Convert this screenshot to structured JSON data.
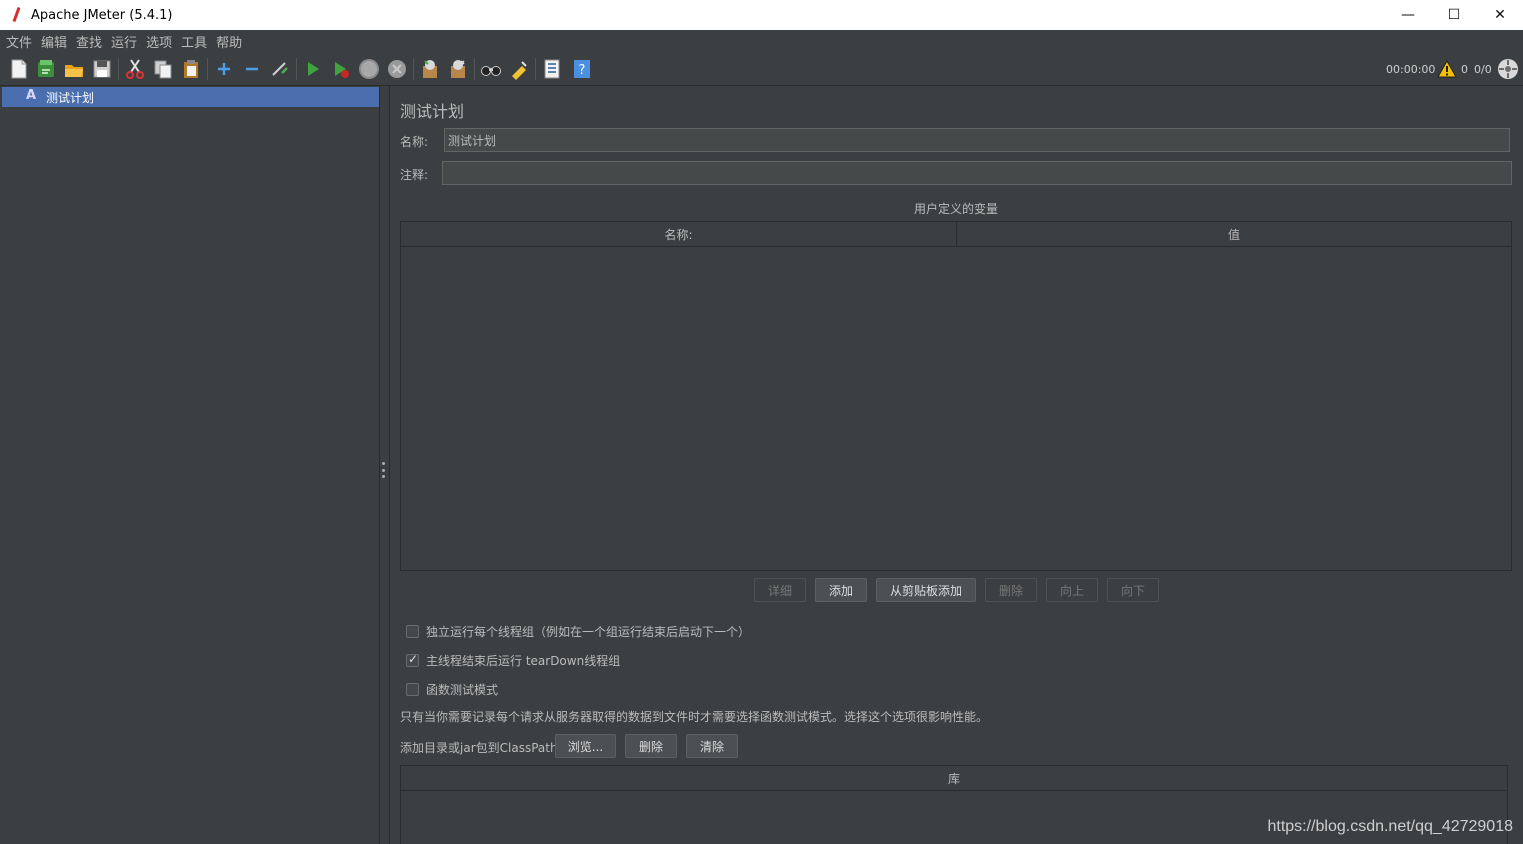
{
  "window": {
    "title": "Apache JMeter (5.4.1)",
    "minimize": "—",
    "maximize": "☐",
    "close": "✕"
  },
  "menu": [
    "文件",
    "编辑",
    "查找",
    "运行",
    "选项",
    "工具",
    "帮助"
  ],
  "toolbar": {
    "icons": [
      "new-icon",
      "templates-icon",
      "open-icon",
      "save-icon",
      "cut-icon",
      "copy-icon",
      "paste-icon",
      "expand-icon",
      "collapse-icon",
      "toggle-icon",
      "start-icon",
      "start-no-pause-icon",
      "stop-icon",
      "shutdown-icon",
      "clear-icon",
      "clear-all-icon",
      "search-icon",
      "reset-search-icon",
      "function-helper-icon",
      "help-icon"
    ],
    "colors": {
      "start": "#3fa33f",
      "accent": "#4b6eaf"
    },
    "timer": "00:00:00",
    "warning_count": "0",
    "threads": "0/0"
  },
  "tree": {
    "selected_item": "测试计划"
  },
  "test_plan": {
    "title": "测试计划",
    "name_label": "名称:",
    "name_value": "测试计划",
    "comment_label": "注释:",
    "comment_value": "",
    "variables_caption": "用户定义的变量",
    "variables_columns": [
      "名称:",
      "值"
    ],
    "buttons": {
      "detail": "详细",
      "add": "添加",
      "add_from_clipboard": "从剪贴板添加",
      "delete": "删除",
      "up": "向上",
      "down": "向下"
    },
    "options": {
      "serialize": {
        "label": "独立运行每个线程组（例如在一个组运行结束后启动下一个）",
        "checked": false
      },
      "teardown": {
        "label": "主线程结束后运行 tearDown线程组",
        "checked": true
      },
      "functional": {
        "label": "函数测试模式",
        "checked": false
      }
    },
    "functional_note": "只有当你需要记录每个请求从服务器取得的数据到文件时才需要选择函数测试模式。选择这个选项很影响性能。",
    "classpath_label": "添加目录或jar包到ClassPath",
    "classpath_buttons": {
      "browse": "浏览...",
      "delete": "删除",
      "clear": "清除"
    },
    "library_column": "库"
  },
  "watermark": "https://blog.csdn.net/qq_42729018"
}
